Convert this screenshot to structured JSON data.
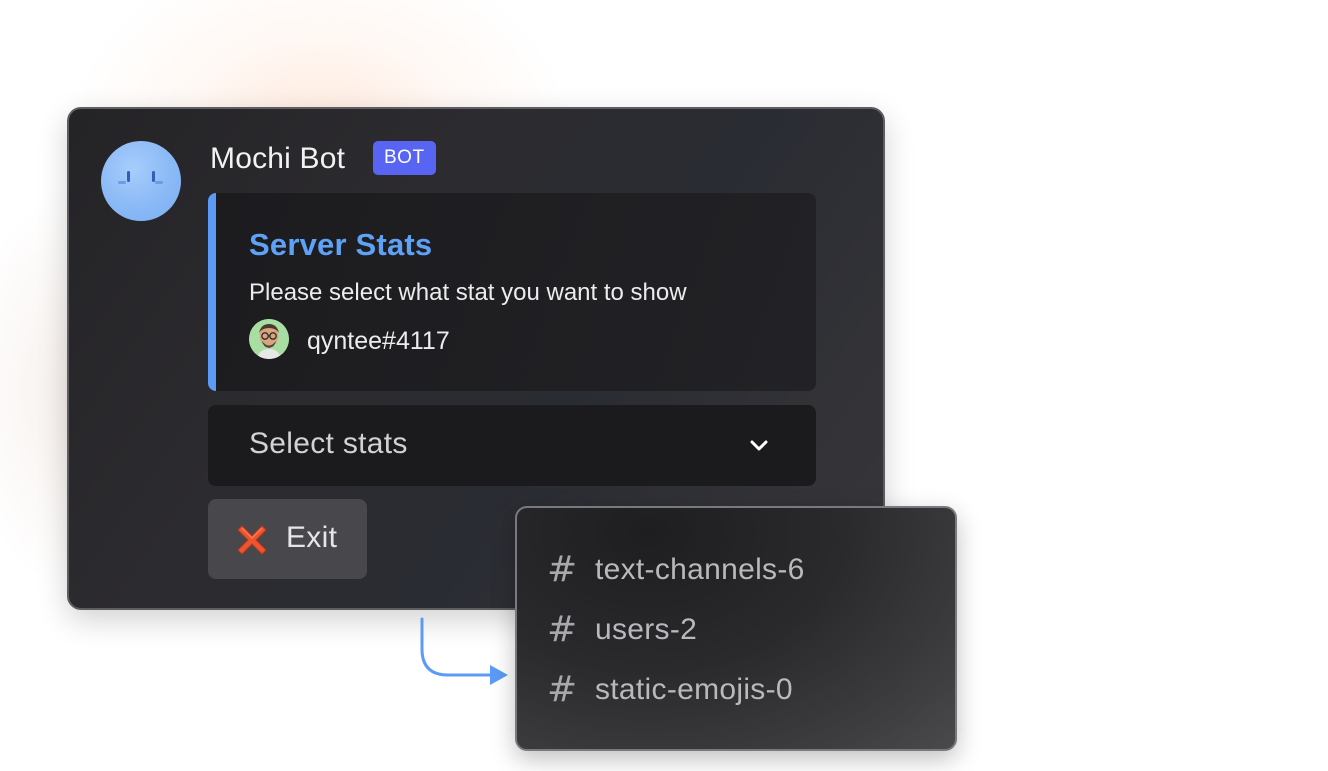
{
  "message": {
    "author": "Mochi Bot",
    "tag": "BOT"
  },
  "embed": {
    "title": "Server Stats",
    "description": "Please select what stat you want to show",
    "user": "qyntee#4117",
    "accent_color": "#5b9bf5"
  },
  "select": {
    "placeholder": "Select stats",
    "icon": "chevron-down-icon"
  },
  "exit_button": {
    "label": "Exit",
    "icon": "cross-mark-icon"
  },
  "dropdown": {
    "options": [
      {
        "icon": "hash-icon",
        "label": "text-channels-6"
      },
      {
        "icon": "hash-icon",
        "label": "users-2"
      },
      {
        "icon": "hash-icon",
        "label": "static-emojis-0"
      }
    ]
  },
  "colors": {
    "brand": "#5865f2",
    "link": "#5ea2f8",
    "arrow": "#5b9bf5"
  }
}
